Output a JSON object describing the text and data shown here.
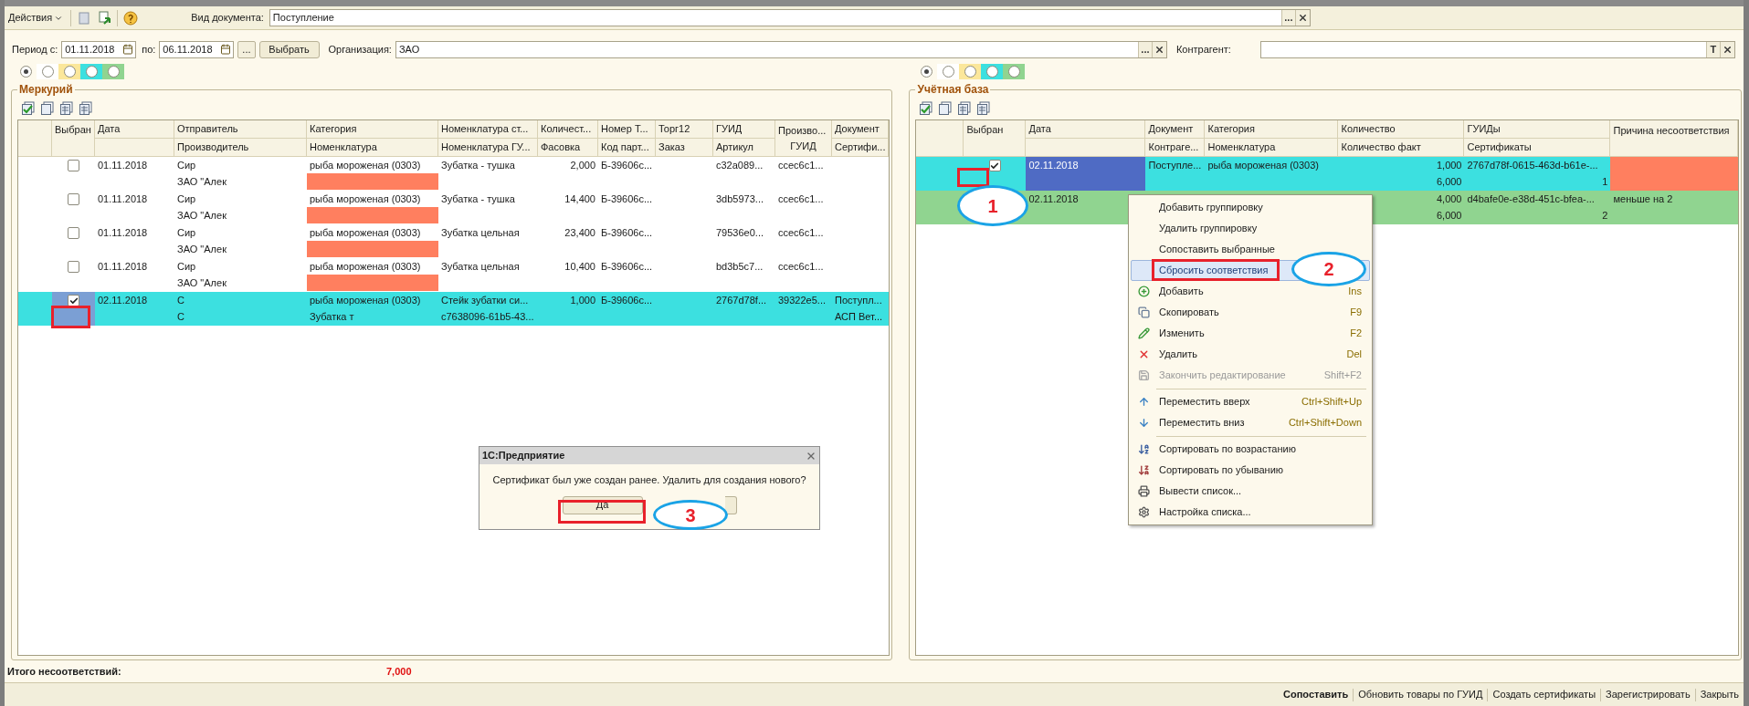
{
  "toolbar": {
    "actions_menu": "Действия",
    "doc_type_label": "Вид документа:",
    "doc_type_value": "Поступление",
    "choose_button": "..."
  },
  "filters": {
    "period_from_label": "Период с:",
    "period_from": "01.11.2018",
    "period_to_label": "по:",
    "period_to": "06.11.2018",
    "period_button": "...",
    "select_button": "Выбрать",
    "org_label": "Организация:",
    "org_value": "ЗАО",
    "org_choose": "...",
    "counterparty_label": "Контрагент:",
    "counterparty_type_button": "T"
  },
  "panels": [
    {
      "title": "Меркурий",
      "active": false,
      "radios": [
        {
          "selected": true,
          "color": "#fdf9ec"
        },
        {
          "selected": false,
          "color": "#ffffff"
        },
        {
          "selected": false,
          "color": "#fbe79b"
        },
        {
          "selected": false,
          "color": "#3ce0e0"
        },
        {
          "selected": false,
          "color": "#90d490"
        }
      ],
      "columns": [
        {
          "kind": "check",
          "top": "Выбран"
        },
        {
          "kind": "text",
          "top": "Дата"
        },
        {
          "kind": "text",
          "top": "Отправитель",
          "bottom": "Производитель"
        },
        {
          "kind": "text",
          "top": "Категория",
          "bottom": "Номенклатура"
        },
        {
          "kind": "text",
          "top": "Номенклатура ст...",
          "bottom": "Номенклатура ГУ..."
        },
        {
          "kind": "number",
          "top": "Количест...",
          "bottom": "Фасовка"
        },
        {
          "kind": "text",
          "top": "Номер Т...",
          "bottom": "Код парт..."
        },
        {
          "kind": "text",
          "top": "Торг12",
          "bottom": "Заказ"
        },
        {
          "kind": "text",
          "top": "ГУИД",
          "bottom": "Артикул"
        },
        {
          "kind": "merged",
          "top": "Произво...",
          "bottom": "ГУИД"
        },
        {
          "kind": "text",
          "top": "Документ",
          "bottom": "Сертифи..."
        }
      ],
      "rows": [
        {
          "color": "#ffffff",
          "cells": [
            {
              "checked": false
            },
            {
              "l1": "01.11.2018"
            },
            {
              "l1": "Сир",
              "l2": "ЗАО \"Алек"
            },
            {
              "l1": "рыба мороженая (0303)",
              "alert": true
            },
            {
              "l1": "Зубатка - тушка"
            },
            {
              "l1": "2,000"
            },
            {
              "l1": "Б-39606с..."
            },
            {},
            {
              "l1": "c32a089..."
            },
            {
              "l1": "ccec6c1..."
            },
            {}
          ]
        },
        {
          "color": "#ffffff",
          "cells": [
            {
              "checked": false
            },
            {
              "l1": "01.11.2018"
            },
            {
              "l1": "Сир",
              "l2": "ЗАО \"Алек"
            },
            {
              "l1": "рыба мороженая (0303)",
              "alert": true
            },
            {
              "l1": "Зубатка - тушка"
            },
            {
              "l1": "14,400"
            },
            {
              "l1": "Б-39606с..."
            },
            {},
            {
              "l1": "3db5973..."
            },
            {
              "l1": "ccec6c1..."
            },
            {}
          ]
        },
        {
          "color": "#ffffff",
          "cells": [
            {
              "checked": false
            },
            {
              "l1": "01.11.2018"
            },
            {
              "l1": "Сир",
              "l2": "ЗАО \"Алек"
            },
            {
              "l1": "рыба мороженая (0303)",
              "alert": true
            },
            {
              "l1": "Зубатка цельная"
            },
            {
              "l1": "23,400"
            },
            {
              "l1": "Б-39606с..."
            },
            {},
            {
              "l1": "79536e0..."
            },
            {
              "l1": "ccec6c1..."
            },
            {}
          ]
        },
        {
          "color": "#ffffff",
          "cells": [
            {
              "checked": false
            },
            {
              "l1": "01.11.2018"
            },
            {
              "l1": "Сир",
              "l2": "ЗАО \"Алек"
            },
            {
              "l1": "рыба мороженая (0303)",
              "alert": true
            },
            {
              "l1": "Зубатка цельная"
            },
            {
              "l1": "10,400"
            },
            {
              "l1": "Б-39606с..."
            },
            {},
            {
              "l1": "bd3b5c7..."
            },
            {
              "l1": "ccec6c1..."
            },
            {}
          ]
        },
        {
          "color": "#3ce0e0",
          "cells": [
            {
              "checked": true,
              "focused": true
            },
            {
              "l1": "02.11.2018"
            },
            {
              "l1": "С",
              "l2": "С"
            },
            {
              "l1": "рыба мороженая (0303)",
              "l2": "Зубатка т"
            },
            {
              "l1": "Стейк зубатки си...",
              "l2": "c7638096-61b5-43..."
            },
            {
              "l1": "1,000"
            },
            {
              "l1": "Б-39606с..."
            },
            {},
            {
              "l1": "2767d78f..."
            },
            {
              "l1": "39322e5..."
            },
            {
              "l1": "Поступл...",
              "l2": "АСП Вет..."
            }
          ]
        }
      ]
    },
    {
      "title": "Учётная база",
      "active": true,
      "radios": [
        {
          "selected": true,
          "color": "#fdf9ec"
        },
        {
          "selected": false,
          "color": "#ffffff"
        },
        {
          "selected": false,
          "color": "#fbe79b"
        },
        {
          "selected": false,
          "color": "#3ce0e0"
        },
        {
          "selected": false,
          "color": "#90d490"
        }
      ],
      "columns": [
        {
          "kind": "check",
          "top": "Выбран"
        },
        {
          "kind": "text",
          "top": "Дата"
        },
        {
          "kind": "text",
          "top": "Документ",
          "bottom": "Контраге..."
        },
        {
          "kind": "text",
          "top": "Категория",
          "bottom": "Номенклатура"
        },
        {
          "kind": "number",
          "top": "Количество",
          "bottom": "Количество факт"
        },
        {
          "kind": "split",
          "top": "ГУИДы",
          "bottom": "Сертификаты"
        },
        {
          "kind": "merged",
          "top": "Причина несоответствия"
        }
      ],
      "rows": [
        {
          "color": "#3ce0e0",
          "cells": [
            {
              "checked": true
            },
            {
              "l1": "02.11.2018",
              "focused": true
            },
            {
              "l1": "Поступле..."
            },
            {
              "l1": "рыба мороженая (0303)"
            },
            {
              "l1": "1,000",
              "l2": "6,000"
            },
            {
              "l1": "2767d78f-0615-463d-b61e-...",
              "l2": "1"
            },
            {
              "alert": true
            }
          ]
        },
        {
          "color": "#90d490",
          "cells": [
            {},
            {
              "l1": "02.11.2018"
            },
            {},
            {},
            {
              "l1": "4,000",
              "l2": "6,000"
            },
            {
              "l1": "d4bafe0e-e38d-451c-bfea-...",
              "l2": "2"
            },
            {
              "l1": "меньше на 2"
            }
          ]
        }
      ]
    }
  ],
  "total": {
    "label": "Итого несоответствий:",
    "value": "7,000"
  },
  "bottom_buttons": [
    {
      "label": "Сопоставить",
      "default": true
    },
    {
      "label": "Обновить товары по ГУИД",
      "default": false
    },
    {
      "label": "Создать сертификаты",
      "default": false
    },
    {
      "label": "Зарегистрировать",
      "default": false
    },
    {
      "label": "Закрыть",
      "default": false
    }
  ],
  "context_menu": {
    "items": [
      {
        "kind": "command",
        "label": "Добавить группировку",
        "selected": false,
        "disabled": false
      },
      {
        "kind": "command",
        "label": "Удалить группировку",
        "selected": false,
        "disabled": false
      },
      {
        "kind": "command",
        "label": "Сопоставить выбранные",
        "selected": false,
        "disabled": false
      },
      {
        "kind": "command",
        "label": "Сбросить соответствия",
        "selected": true,
        "disabled": false
      },
      {
        "kind": "command",
        "label": "Добавить",
        "shortcut": "Ins",
        "selected": false,
        "disabled": false
      },
      {
        "kind": "command",
        "label": "Скопировать",
        "shortcut": "F9",
        "selected": false,
        "disabled": false
      },
      {
        "kind": "command",
        "label": "Изменить",
        "shortcut": "F2",
        "selected": false,
        "disabled": false
      },
      {
        "kind": "command",
        "label": "Удалить",
        "shortcut": "Del",
        "selected": false,
        "disabled": false
      },
      {
        "kind": "command",
        "label": "Закончить редактирование",
        "shortcut": "Shift+F2",
        "selected": false,
        "disabled": true
      },
      {
        "kind": "separator"
      },
      {
        "kind": "command",
        "label": "Переместить вверх",
        "shortcut": "Ctrl+Shift+Up",
        "selected": false,
        "disabled": false
      },
      {
        "kind": "command",
        "label": "Переместить вниз",
        "shortcut": "Ctrl+Shift+Down",
        "selected": false,
        "disabled": false
      },
      {
        "kind": "separator"
      },
      {
        "kind": "command",
        "label": "Сортировать по возрастанию",
        "selected": false,
        "disabled": false
      },
      {
        "kind": "command",
        "label": "Сортировать по убыванию",
        "selected": false,
        "disabled": false
      },
      {
        "kind": "command",
        "label": "Вывести список...",
        "selected": false,
        "disabled": false
      },
      {
        "kind": "command",
        "label": "Настройка списка...",
        "selected": false,
        "disabled": false
      }
    ]
  },
  "dialog": {
    "title": "1С:Предприятие",
    "message": "Сертификат был уже создан ранее. Удалить для создания нового?",
    "buttons": [
      {
        "kind": "labeled",
        "label": "Да"
      },
      {
        "kind": "covered"
      }
    ]
  },
  "annotations": [
    {
      "kind": "box"
    },
    {
      "kind": "box"
    },
    {
      "kind": "ellipse",
      "label": "1"
    },
    {
      "kind": "box"
    },
    {
      "kind": "ellipse",
      "label": "2"
    },
    {
      "kind": "box"
    },
    {
      "kind": "ellipse",
      "label": "3"
    }
  ]
}
